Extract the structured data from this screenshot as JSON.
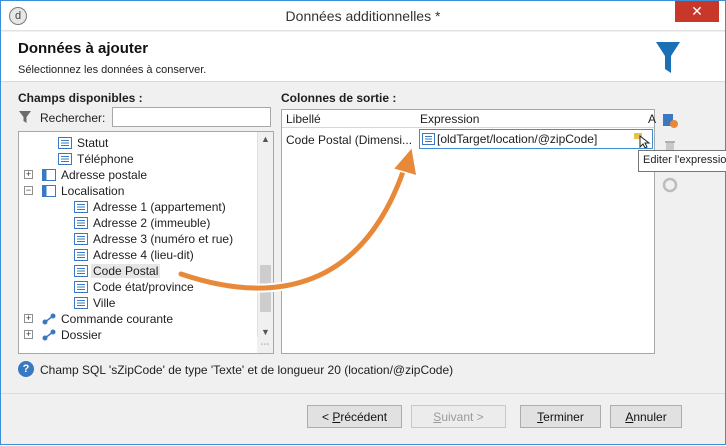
{
  "window": {
    "app_icon": "d",
    "title": "Données additionnelles *",
    "close_glyph": "✕"
  },
  "header": {
    "title": "Données à ajouter",
    "subtitle": "Sélectionnez les données à conserver."
  },
  "left": {
    "section_label": "Champs disponibles :",
    "search_label": "Rechercher:",
    "search_value": "",
    "tree": [
      {
        "label": "Statut",
        "icon": "field-icon"
      },
      {
        "label": "Téléphone",
        "icon": "field-icon"
      },
      {
        "label": "Adresse postale",
        "icon": "folder-icon",
        "expander": "+"
      },
      {
        "label": "Localisation",
        "icon": "folder-icon",
        "expander": "−"
      },
      {
        "label": "Adresse 1 (appartement)",
        "icon": "field-icon"
      },
      {
        "label": "Adresse 2 (immeuble)",
        "icon": "field-icon"
      },
      {
        "label": "Adresse 3 (numéro et rue)",
        "icon": "field-icon"
      },
      {
        "label": "Adresse 4 (lieu-dit)",
        "icon": "field-icon"
      },
      {
        "label": "Code Postal",
        "icon": "field-icon",
        "selected": true
      },
      {
        "label": "Code état/province",
        "icon": "field-icon"
      },
      {
        "label": "Ville",
        "icon": "field-icon"
      },
      {
        "label": "Commande courante",
        "icon": "link-icon",
        "expander": "+"
      },
      {
        "label": "Dossier",
        "icon": "link-icon",
        "expander": "+"
      }
    ]
  },
  "right": {
    "section_label": "Colonnes de sortie :",
    "columns": [
      "Libellé",
      "Expression",
      "A"
    ],
    "rows": [
      {
        "label": "Code Postal (Dimensi...",
        "expression": "[oldTarget/location/@zipCode]"
      }
    ],
    "tooltip": "Editer l'expression"
  },
  "info": {
    "text": "Champ SQL 'sZipCode' de type 'Texte' et de longueur 20 (location/@zipCode)"
  },
  "buttons": {
    "prev": "< Précédent",
    "next": "Suivant >",
    "finish": "Terminer",
    "cancel": "Annuler"
  },
  "colors": {
    "accent": "#1b6fb5",
    "close": "#c7382a",
    "arrow": "#e8893a",
    "selection": "#e6e6e6"
  }
}
